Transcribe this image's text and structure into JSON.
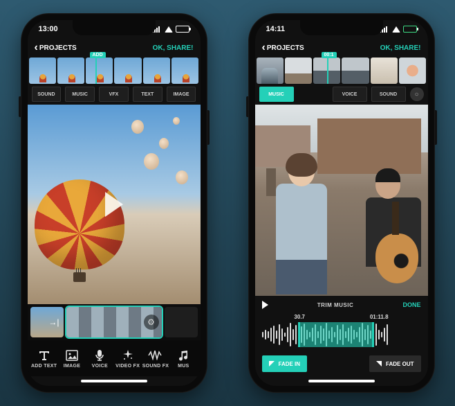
{
  "colors": {
    "accent": "#24d0b8"
  },
  "screen1": {
    "status": {
      "time": "13:00",
      "battery_pct": 70
    },
    "nav": {
      "back": "PROJECTS",
      "share": "OK, SHARE!"
    },
    "playhead_tag": "ADD",
    "categories": [
      "SOUND",
      "MUSIC",
      "VFX",
      "TEXT",
      "IMAGE"
    ],
    "tools": [
      {
        "id": "add-text",
        "label": "ADD TEXT"
      },
      {
        "id": "image",
        "label": "IMAGE"
      },
      {
        "id": "voice",
        "label": "VOICE"
      },
      {
        "id": "video-fx",
        "label": "VIDEO FX"
      },
      {
        "id": "sound-fx",
        "label": "SOUND FX"
      },
      {
        "id": "music",
        "label": "MUS"
      }
    ]
  },
  "screen2": {
    "status": {
      "time": "14:11",
      "battery_pct": 90
    },
    "nav": {
      "back": "PROJECTS",
      "share": "OK, SHARE!"
    },
    "playhead_tag": "00:1",
    "categories": [
      "MUSIC",
      "VOICE",
      "SOUND"
    ],
    "active_category": "MUSIC",
    "trim": {
      "title": "TRIM MUSIC",
      "done": "DONE",
      "t_start": "30.7",
      "t_end": "01:11.8",
      "fade_in": "FADE IN",
      "fade_out": "FADE OUT"
    }
  }
}
